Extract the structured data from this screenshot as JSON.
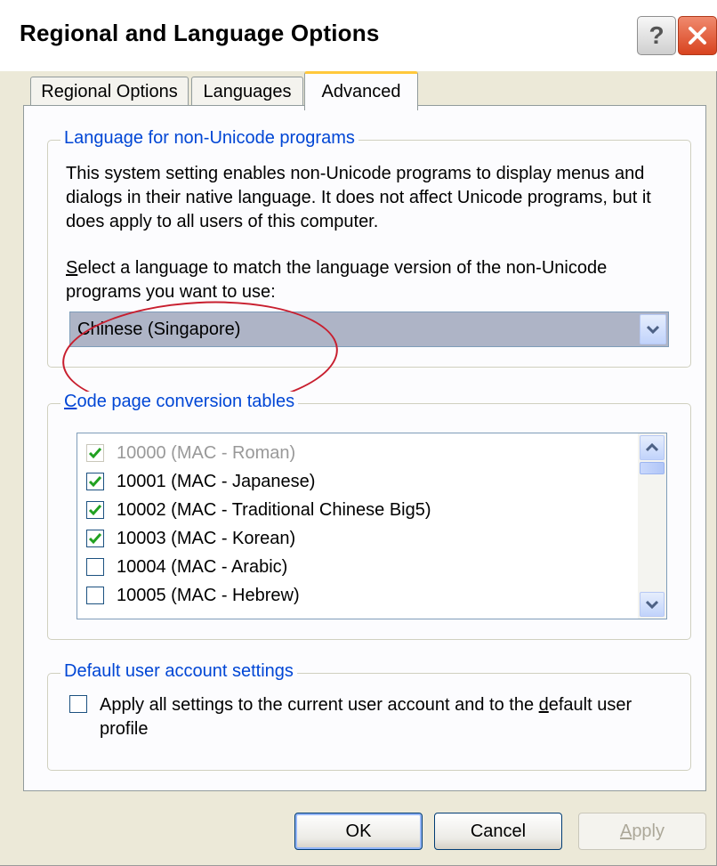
{
  "window": {
    "title": "Regional and Language Options"
  },
  "titlebar": {
    "help_glyph": "?"
  },
  "tabs": [
    {
      "label": "Regional Options",
      "selected": false
    },
    {
      "label": "Languages",
      "selected": false
    },
    {
      "label": "Advanced",
      "selected": true
    }
  ],
  "non_unicode": {
    "legend": "Language for non-Unicode programs",
    "description": "This system setting enables non-Unicode programs to display menus and dialogs in their native language. It does not affect Unicode programs, but it does apply to all users of this computer.",
    "select_label_mnemonic": "S",
    "select_label_rest": "elect a language to match the language version of the non-Unicode programs you want to use:",
    "selected_language": "Chinese (Singapore)"
  },
  "code_pages": {
    "legend_mnemonic": "C",
    "legend_rest": "ode page conversion tables",
    "items": [
      {
        "label": "10000 (MAC - Roman)",
        "checked": true,
        "disabled": true
      },
      {
        "label": "10001 (MAC - Japanese)",
        "checked": true,
        "disabled": false
      },
      {
        "label": "10002 (MAC - Traditional Chinese Big5)",
        "checked": true,
        "disabled": false
      },
      {
        "label": "10003 (MAC - Korean)",
        "checked": true,
        "disabled": false
      },
      {
        "label": "10004 (MAC - Arabic)",
        "checked": false,
        "disabled": false
      },
      {
        "label": "10005 (MAC - Hebrew)",
        "checked": false,
        "disabled": false
      }
    ]
  },
  "default_user": {
    "legend": "Default user account settings",
    "checkbox_label_before": "Apply all settings to the current user account and to the ",
    "checkbox_label_mnemonic": "d",
    "checkbox_label_after": "efault user profile",
    "checked": false
  },
  "buttons": {
    "ok": "OK",
    "cancel": "Cancel",
    "apply_mnemonic": "A",
    "apply_rest": "pply"
  },
  "colors": {
    "group_legend": "#0046d5",
    "annotation": "#c81e2e",
    "checkmark": "#21a121",
    "tab_highlight": "#ffc83c"
  }
}
